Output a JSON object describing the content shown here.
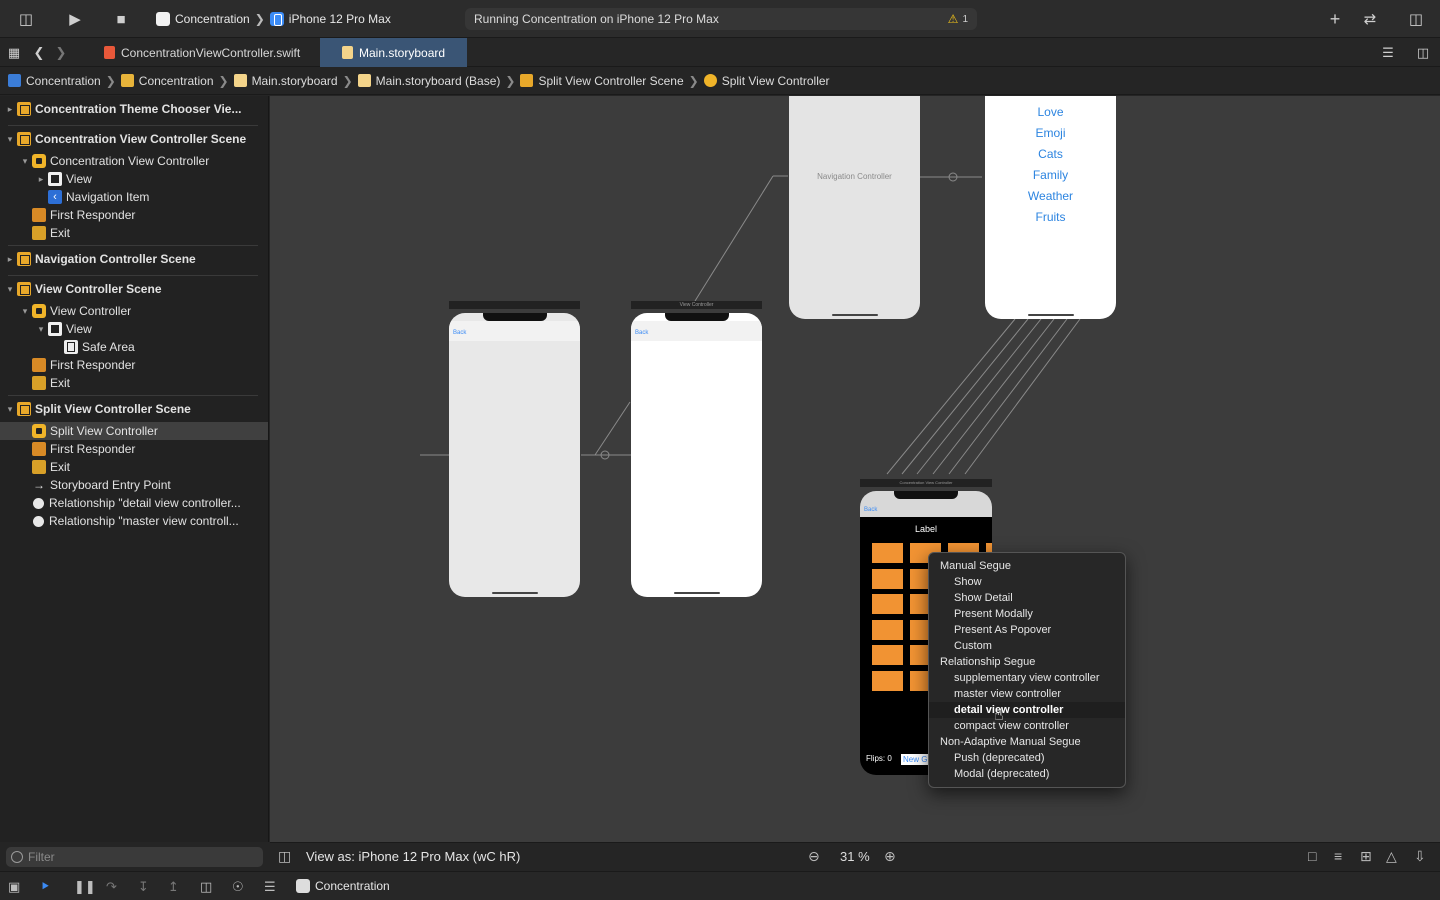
{
  "toolbar": {
    "scheme_app": "Concentration",
    "scheme_device": "iPhone 12 Pro Max",
    "status_text": "Running Concentration on iPhone 12 Pro Max",
    "warning_count": "1"
  },
  "tabs": [
    {
      "label": "ConcentrationViewController.swift"
    },
    {
      "label": "Main.storyboard"
    }
  ],
  "breadcrumb": [
    "Concentration",
    "Concentration",
    "Main.storyboard",
    "Main.storyboard (Base)",
    "Split View Controller Scene",
    "Split View Controller"
  ],
  "outline": {
    "rows": [
      "Concentration Theme Chooser Vie...",
      "Concentration View Controller Scene",
      "Concentration View Controller",
      "View",
      "Navigation Item",
      "First Responder",
      "Exit",
      "Navigation Controller Scene",
      "View Controller Scene",
      "View Controller",
      "View",
      "Safe Area",
      "First Responder",
      "Exit",
      "Split View Controller Scene",
      "Split View Controller",
      "First Responder",
      "Exit",
      "Storyboard Entry Point",
      "Relationship \"detail view controller...",
      "Relationship \"master view controll..."
    ],
    "filter_placeholder": "Filter"
  },
  "canvas": {
    "theme_items": [
      "Love",
      "Emoji",
      "Cats",
      "Family",
      "Weather",
      "Fruits"
    ],
    "nav_controller_label": "Navigation Controller",
    "view_controller_bar": "View Controller",
    "concentration_bar": "Concentration View Controller",
    "back_label": "Back",
    "game_label": "Label",
    "flips_label": "Flips: 0",
    "new_game_label": "New G"
  },
  "segue_menu": {
    "items": [
      {
        "label": "Manual Segue",
        "kind": "head"
      },
      {
        "label": "Show",
        "kind": "item"
      },
      {
        "label": "Show Detail",
        "kind": "item"
      },
      {
        "label": "Present Modally",
        "kind": "item"
      },
      {
        "label": "Present As Popover",
        "kind": "item"
      },
      {
        "label": "Custom",
        "kind": "item"
      },
      {
        "label": "Relationship Segue",
        "kind": "head"
      },
      {
        "label": "supplementary view controller",
        "kind": "item"
      },
      {
        "label": "master view controller",
        "kind": "item"
      },
      {
        "label": "detail view controller",
        "kind": "item"
      },
      {
        "label": "compact view controller",
        "kind": "item"
      },
      {
        "label": "Non-Adaptive Manual Segue",
        "kind": "head"
      },
      {
        "label": "Push (deprecated)",
        "kind": "item"
      },
      {
        "label": "Modal (deprecated)",
        "kind": "item"
      }
    ],
    "highlighted": "detail view controller"
  },
  "footer": {
    "view_as": "View as: iPhone 12 Pro Max (wC hR)",
    "zoom": "31 %"
  },
  "debug": {
    "target": "Concentration"
  },
  "colors": {
    "accent": "#3a5575",
    "card": "#f19333",
    "link": "#2c84e0",
    "warning": "#f5c518"
  }
}
